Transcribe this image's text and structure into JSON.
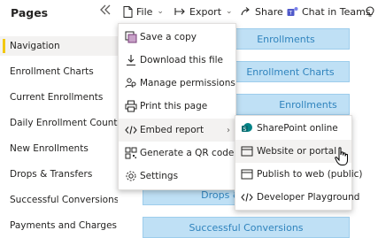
{
  "pages_pane": {
    "title": "Pages",
    "items": [
      {
        "label": "Navigation",
        "active": true
      },
      {
        "label": "Enrollment Charts"
      },
      {
        "label": "Current Enrollments"
      },
      {
        "label": "Daily Enrollment Count"
      },
      {
        "label": "New Enrollments"
      },
      {
        "label": "Drops & Transfers"
      },
      {
        "label": "Successful Conversions"
      },
      {
        "label": "Payments and Charges"
      }
    ]
  },
  "toolbar": {
    "file_label": "File",
    "export_label": "Export",
    "share_label": "Share",
    "chat_label": "Chat in Teams"
  },
  "canvas": {
    "buttons": [
      {
        "label": "Enrollments"
      },
      {
        "label": "Enrollment Charts"
      },
      {
        "label": "Enrollments"
      },
      {
        "label": ""
      },
      {
        "label": ""
      },
      {
        "label": ""
      },
      {
        "label": ""
      },
      {
        "label": "Drops & Transfers"
      },
      {
        "label": ""
      },
      {
        "label": "Successful Conversions"
      }
    ]
  },
  "file_menu": {
    "items": [
      {
        "label": "Save a copy",
        "icon": "save-copy-icon"
      },
      {
        "label": "Download this file",
        "icon": "download-icon"
      },
      {
        "label": "Manage permissions",
        "icon": "people-icon"
      },
      {
        "label": "Print this page",
        "icon": "print-icon"
      },
      {
        "label": "Embed report",
        "icon": "code-icon",
        "has_submenu": true,
        "hover": true
      },
      {
        "label": "Generate a QR code",
        "icon": "qr-code-icon"
      },
      {
        "label": "Settings",
        "icon": "gear-icon"
      }
    ]
  },
  "embed_submenu": {
    "items": [
      {
        "label": "SharePoint online",
        "icon": "sharepoint-icon"
      },
      {
        "label": "Website or portal",
        "icon": "website-icon",
        "hover": true
      },
      {
        "label": "Publish to web (public)",
        "icon": "window-icon"
      },
      {
        "label": "Developer Playground",
        "icon": "code-icon"
      }
    ]
  },
  "colors": {
    "accent_yellow": "#f2c811",
    "nav_button_bg": "#bfe0f5",
    "nav_button_text": "#2f83bd",
    "sharepoint_green": "#038387",
    "teams_purple": "#5059c9"
  }
}
